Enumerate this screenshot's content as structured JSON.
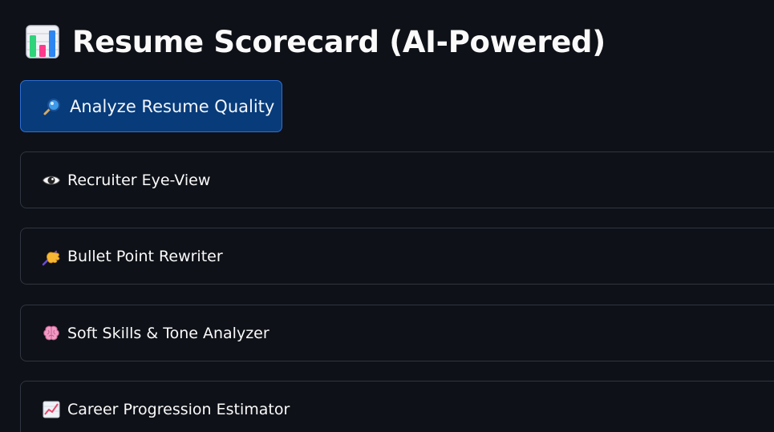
{
  "header": {
    "title": "Resume Scorecard (AI-Powered)",
    "title_icon": "bar-chart-icon"
  },
  "actions": {
    "analyze_label": "Analyze Resume Quality",
    "analyze_icon": "magnifier-icon"
  },
  "sections": [
    {
      "label": "Recruiter Eye-View",
      "icon": "eye-icon"
    },
    {
      "label": "Bullet Point Rewriter",
      "icon": "writing-hand-icon"
    },
    {
      "label": "Soft Skills & Tone Analyzer",
      "icon": "brain-icon"
    },
    {
      "label": "Career Progression Estimator",
      "icon": "chart-increasing-icon"
    }
  ],
  "colors": {
    "background": "#0e1117",
    "primary_button": "#073b7a",
    "primary_border": "#2f6fd6",
    "expander_border": "#303540",
    "text": "#fafafa"
  }
}
